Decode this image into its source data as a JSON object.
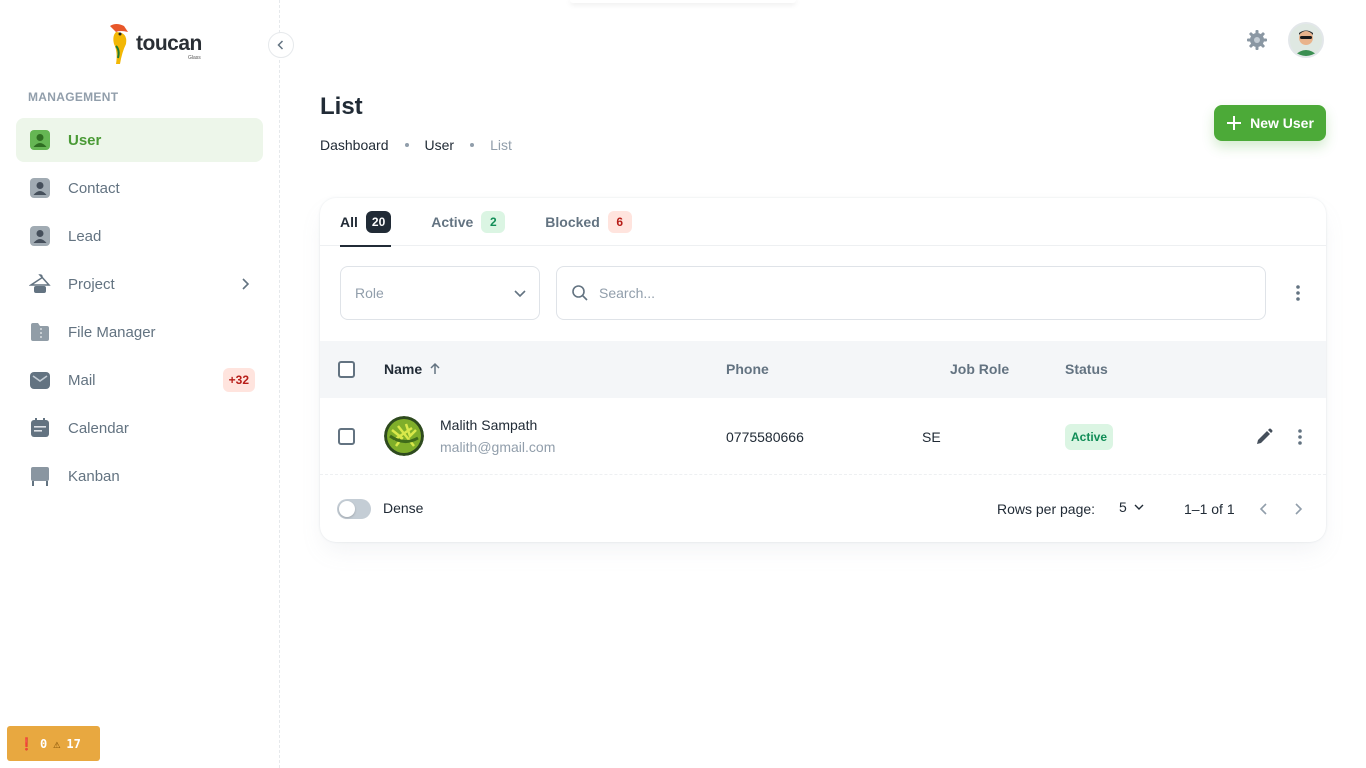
{
  "brand": {
    "name": "toucan",
    "tagline": "Glass"
  },
  "sidebar": {
    "section_label": "MANAGEMENT",
    "items": [
      {
        "label": "User",
        "icon": "user-icon",
        "active": true
      },
      {
        "label": "Contact",
        "icon": "contact-icon"
      },
      {
        "label": "Lead",
        "icon": "lead-icon"
      },
      {
        "label": "Project",
        "icon": "project-icon",
        "has_children": true
      },
      {
        "label": "File Manager",
        "icon": "folder-icon"
      },
      {
        "label": "Mail",
        "icon": "mail-icon",
        "badge": "+32"
      },
      {
        "label": "Calendar",
        "icon": "calendar-icon"
      },
      {
        "label": "Kanban",
        "icon": "kanban-icon"
      }
    ]
  },
  "dev_badge": {
    "errors": "0",
    "warnings": "17"
  },
  "header": {
    "settings_icon": "gear-icon"
  },
  "page": {
    "title": "List",
    "breadcrumb": [
      "Dashboard",
      "User",
      "List"
    ],
    "new_button_label": "New User"
  },
  "tabs": [
    {
      "label": "All",
      "count": "20",
      "active": true
    },
    {
      "label": "Active",
      "count": "2"
    },
    {
      "label": "Blocked",
      "count": "6"
    }
  ],
  "filters": {
    "role_placeholder": "Role",
    "search_placeholder": "Search..."
  },
  "table": {
    "columns": [
      "Name",
      "Phone",
      "Job Role",
      "Status"
    ],
    "rows": [
      {
        "name": "Malith Sampath",
        "email": "malith@gmail.com",
        "phone": "0775580666",
        "job_role": "SE",
        "status": "Active"
      }
    ]
  },
  "footer": {
    "dense_label": "Dense",
    "rows_per_page_label": "Rows per page:",
    "rows_per_page_value": "5",
    "range": "1–1 of 1"
  },
  "colors": {
    "accent": "#4caa38",
    "active_bg": "#edf6ea"
  }
}
